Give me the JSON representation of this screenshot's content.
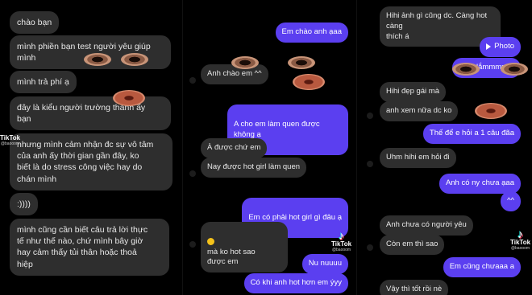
{
  "left_panel": {
    "messages": [
      {
        "text": "chào bạn"
      },
      {
        "text": "mình phiền bạn test người yêu giúp\nmình"
      },
      {
        "text": "mình trả phí ạ"
      },
      {
        "text": "đây là kiểu người trường thành ấy\nbạn"
      },
      {
        "text": "nhưng mình cảm nhận đc sự vô tâm\ncủa anh ấy thời gian gần đây, ko\nbiết là do stress công việc hay do\nchán mình"
      },
      {
        "text": ":))))"
      },
      {
        "text": "mình cũng cần biết câu trả lời thực\ntế như thế nào, chứ mình bây giờ\nhay cảm thấy tủi thân hoặc thoả\nhiệp"
      }
    ],
    "tiktok": {
      "brand": "TikTok",
      "handle": "@baooom"
    }
  },
  "middle_panel": {
    "messages": [
      {
        "text": "Em chào anh ạaa",
        "side": "out"
      },
      {
        "text": "Anh chào em ^^",
        "side": "in"
      },
      {
        "text": "A cho em làm quen được không ạ",
        "side": "out"
      },
      {
        "text": "À được chứ em",
        "side": "in"
      },
      {
        "text": "Nay được hot girl làm quen",
        "side": "in"
      },
      {
        "text": "Em có phải hot girl gì đâu ạ",
        "side": "out"
      },
      {
        "text": "mà ko hot sao\nđược em",
        "side": "in"
      },
      {
        "text": "Nu nuuuu",
        "side": "out"
      },
      {
        "text": "Có khi anh hot hơn em ýyy",
        "side": "out"
      }
    ],
    "tiktok": {
      "brand": "TikTok",
      "handle": "@baooom"
    }
  },
  "right_panel": {
    "messages": [
      {
        "text": "Hihi ảnh gì cũng dc. Càng hot càng\nthích á",
        "side": "in"
      },
      {
        "text": "Photo",
        "side": "out"
      },
      {
        "text": "Ngại lắmmmmm",
        "side": "out"
      },
      {
        "text": "Hihi đẹp gái mà",
        "side": "in"
      },
      {
        "text": "anh xem nữa dc ko",
        "side": "in"
      },
      {
        "text": "Thế để e hỏi a 1 câu đãa",
        "side": "out"
      },
      {
        "text": "Uhm hihi em hỏi đi",
        "side": "in"
      },
      {
        "text": "Anh có ny chưa ạaa",
        "side": "out"
      },
      {
        "text": "^^",
        "side": "out"
      },
      {
        "text": "Anh chưa có người yêu",
        "side": "in"
      },
      {
        "text": "Còn em thì sao",
        "side": "in"
      },
      {
        "text": "Em cũng chưaaa a",
        "side": "out"
      },
      {
        "text": "Vậy thì tốt rồi nè",
        "side": "in"
      }
    ],
    "tiktok": {
      "brand": "TikTok",
      "handle": "@baooom"
    }
  },
  "colors": {
    "incoming_bubble": "#2e2e2e",
    "outgoing_bubble": "#5b3ff0",
    "background": "#000000"
  },
  "icons": {
    "play": "play-icon",
    "emoji": "emoji-icon",
    "tiktok": "tiktok-logo-icon"
  }
}
